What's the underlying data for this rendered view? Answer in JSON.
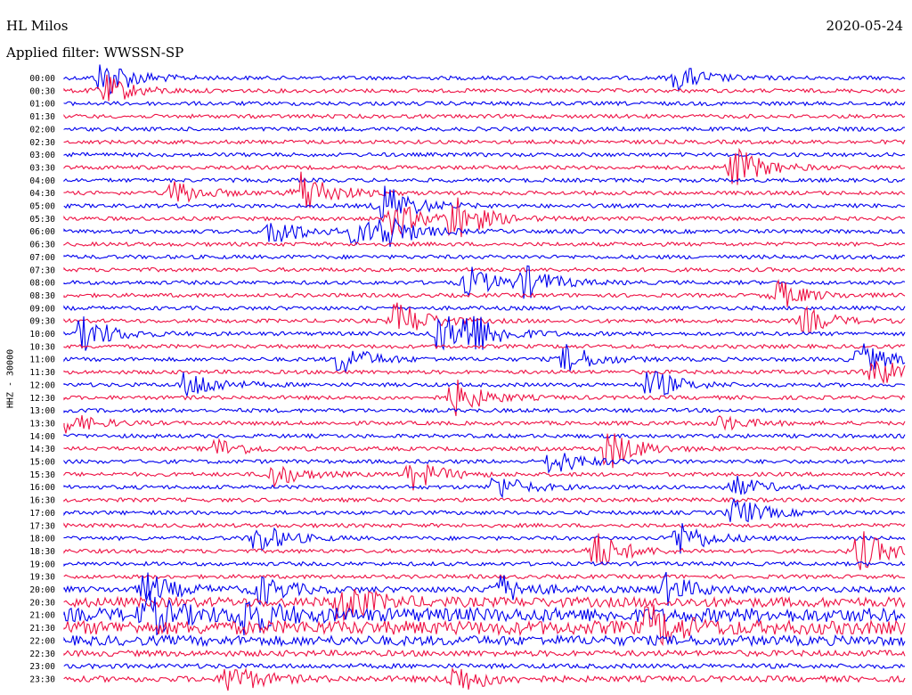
{
  "header": {
    "station": "HL Milos",
    "date": "2020-05-24",
    "filter_label": "Applied filter: WWSSN-SP"
  },
  "colors": {
    "trace_blue": "#0000ee",
    "trace_red": "#ee1144",
    "background": "#ffffff"
  },
  "chart_data": {
    "type": "line",
    "subtype": "helicorder",
    "ylabel": "HHZ - 30000",
    "rows": [
      "00:00",
      "00:30",
      "01:00",
      "01:30",
      "02:00",
      "02:30",
      "03:00",
      "03:30",
      "04:00",
      "04:30",
      "05:00",
      "05:30",
      "06:00",
      "06:30",
      "07:00",
      "07:30",
      "08:00",
      "08:30",
      "09:00",
      "09:30",
      "10:00",
      "10:30",
      "11:00",
      "11:30",
      "12:00",
      "12:30",
      "13:00",
      "13:30",
      "14:00",
      "14:30",
      "15:00",
      "15:30",
      "16:00",
      "16:30",
      "17:00",
      "17:30",
      "18:00",
      "18:30",
      "19:00",
      "19:30",
      "20:00",
      "20:30",
      "21:00",
      "21:30",
      "22:00",
      "22:30",
      "23:00",
      "23:30"
    ],
    "row_minutes": 30,
    "series_colors": [
      "blue",
      "red"
    ],
    "noise_level_by_row": [
      1,
      1,
      1,
      1,
      1,
      1,
      1,
      1,
      1,
      1,
      1,
      1,
      1,
      1,
      1,
      1,
      1,
      1,
      1,
      1,
      1,
      1,
      1,
      1,
      1,
      1,
      1,
      1,
      1,
      1,
      1,
      1,
      1,
      1,
      1,
      1,
      1,
      1,
      1,
      1,
      1.5,
      2.5,
      3.5,
      3.5,
      2.5,
      1.5,
      1.2,
      1.5
    ],
    "events": [
      {
        "row": 0,
        "minute": 1.5,
        "amp": 4
      },
      {
        "row": 0,
        "minute": 22,
        "amp": 2.5
      },
      {
        "row": 1,
        "minute": 1.5,
        "amp": 3
      },
      {
        "row": 7,
        "minute": 24,
        "amp": 4
      },
      {
        "row": 9,
        "minute": 4,
        "amp": 2.5
      },
      {
        "row": 9,
        "minute": 8.5,
        "amp": 5
      },
      {
        "row": 10,
        "minute": 11.5,
        "amp": 4.5
      },
      {
        "row": 11,
        "minute": 11.8,
        "amp": 3.5
      },
      {
        "row": 11,
        "minute": 14,
        "amp": 4.5
      },
      {
        "row": 12,
        "minute": 7.5,
        "amp": 3
      },
      {
        "row": 12,
        "minute": 10.5,
        "amp": 2.5
      },
      {
        "row": 12,
        "minute": 11.5,
        "amp": 3
      },
      {
        "row": 16,
        "minute": 14.5,
        "amp": 3
      },
      {
        "row": 16,
        "minute": 16.5,
        "amp": 3
      },
      {
        "row": 17,
        "minute": 25.5,
        "amp": 3
      },
      {
        "row": 19,
        "minute": 12,
        "amp": 4
      },
      {
        "row": 19,
        "minute": 26.5,
        "amp": 2.5
      },
      {
        "row": 20,
        "minute": 0.8,
        "amp": 3.5
      },
      {
        "row": 20,
        "minute": 13.5,
        "amp": 4
      },
      {
        "row": 20,
        "minute": 14.5,
        "amp": 4
      },
      {
        "row": 22,
        "minute": 10,
        "amp": 3
      },
      {
        "row": 22,
        "minute": 18,
        "amp": 3
      },
      {
        "row": 22,
        "minute": 28.5,
        "amp": 3
      },
      {
        "row": 23,
        "minute": 29,
        "amp": 3
      },
      {
        "row": 24,
        "minute": 4.5,
        "amp": 3
      },
      {
        "row": 24,
        "minute": 21,
        "amp": 3
      },
      {
        "row": 25,
        "minute": 14,
        "amp": 3.5
      },
      {
        "row": 27,
        "minute": 0.2,
        "amp": 2
      },
      {
        "row": 27,
        "minute": 23.5,
        "amp": 1.5
      },
      {
        "row": 29,
        "minute": 5.5,
        "amp": 2
      },
      {
        "row": 29,
        "minute": 19.5,
        "amp": 4
      },
      {
        "row": 30,
        "minute": 17.5,
        "amp": 2.5
      },
      {
        "row": 31,
        "minute": 7.5,
        "amp": 2.5
      },
      {
        "row": 31,
        "minute": 12.5,
        "amp": 3
      },
      {
        "row": 32,
        "minute": 15.5,
        "amp": 2.5
      },
      {
        "row": 32,
        "minute": 24,
        "amp": 2
      },
      {
        "row": 34,
        "minute": 24,
        "amp": 3
      },
      {
        "row": 36,
        "minute": 7,
        "amp": 3
      },
      {
        "row": 36,
        "minute": 22,
        "amp": 3.5
      },
      {
        "row": 37,
        "minute": 19,
        "amp": 4
      },
      {
        "row": 37,
        "minute": 28.5,
        "amp": 4
      },
      {
        "row": 40,
        "minute": 3,
        "amp": 3
      },
      {
        "row": 40,
        "minute": 7,
        "amp": 3
      },
      {
        "row": 40,
        "minute": 15.5,
        "amp": 3
      },
      {
        "row": 40,
        "minute": 21.5,
        "amp": 3
      },
      {
        "row": 41,
        "minute": 10,
        "amp": 4
      },
      {
        "row": 42,
        "minute": 3,
        "amp": 4
      },
      {
        "row": 42,
        "minute": 6.5,
        "amp": 4
      },
      {
        "row": 43,
        "minute": 21,
        "amp": 4
      },
      {
        "row": 47,
        "minute": 6,
        "amp": 3
      },
      {
        "row": 47,
        "minute": 14,
        "amp": 3
      }
    ]
  }
}
